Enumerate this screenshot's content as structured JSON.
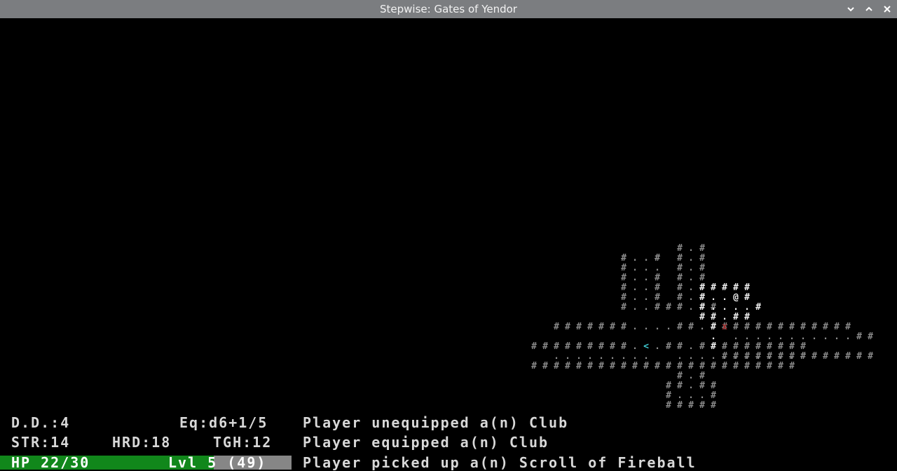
{
  "window": {
    "title": "Stepwise: Gates of Yendor",
    "buttons": [
      "chevron-down",
      "chevron-up",
      "close"
    ]
  },
  "stats": {
    "dd": "D.D.:4",
    "eq": "Eq:d6+1/5",
    "str": "STR:14",
    "hrd": "HRD:18",
    "tgh": "TGH:12",
    "hp": "HP 22/30",
    "lvl": "Lvl 5 (49)",
    "hp_fraction": 0.733
  },
  "log": [
    "Player unequipped a(n) Club",
    "Player equipped a(n) Club",
    "Player picked up a(n) Scroll of Fireball"
  ],
  "colors": {
    "titlebar": "#7b7d80",
    "hp_fill": "#11871b",
    "hp_empty": "#868686",
    "stairs": "#3fc9d0",
    "enemy": "#a12a2a"
  },
  "map_tiles": [
    "#..# #:#",
    "#.#  #:#"
  ]
}
